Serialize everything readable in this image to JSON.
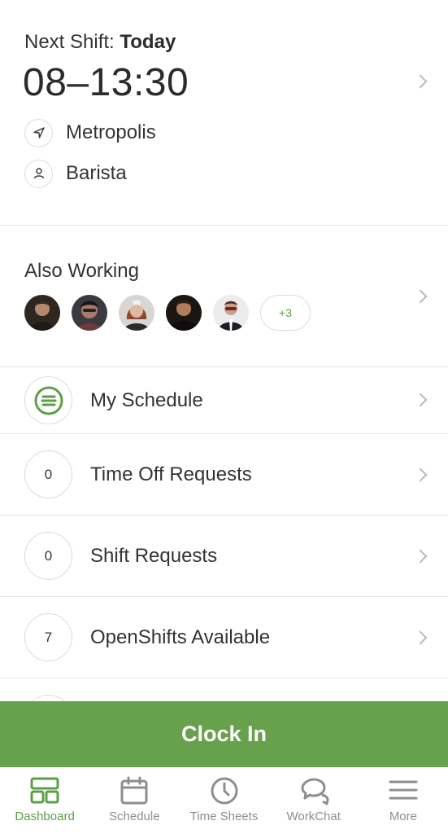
{
  "next_shift": {
    "label": "Next Shift:",
    "day": "Today",
    "time": "08–13:30",
    "location": "Metropolis",
    "position": "Barista",
    "location_icon": "navigation-arrow-icon",
    "position_icon": "person-icon"
  },
  "also_working": {
    "title": "Also Working",
    "avatar_count": 5,
    "more_label": "+3"
  },
  "list": [
    {
      "name": "my-schedule",
      "badge": "",
      "icon": "list-circle-icon",
      "label": "My Schedule"
    },
    {
      "name": "time-off-requests",
      "badge": "0",
      "label": "Time Off Requests"
    },
    {
      "name": "shift-requests",
      "badge": "0",
      "label": "Shift Requests"
    },
    {
      "name": "openshifts-available",
      "badge": "7",
      "label": "OpenShifts Available"
    }
  ],
  "clock_in": {
    "label": "Clock In",
    "color": "#67a14c"
  },
  "tabs": [
    {
      "label": "Dashboard",
      "icon": "dashboard-icon",
      "active": true
    },
    {
      "label": "Schedule",
      "icon": "calendar-icon",
      "active": false
    },
    {
      "label": "Time Sheets",
      "icon": "clock-icon",
      "active": false
    },
    {
      "label": "WorkChat",
      "icon": "chat-bubbles-icon",
      "active": false
    },
    {
      "label": "More",
      "icon": "hamburger-menu-icon",
      "active": false
    }
  ],
  "colors": {
    "accent": "#5d9e48",
    "button": "#67a14c",
    "divider": "#e6e6e6",
    "inactive": "#8e8e8e"
  }
}
